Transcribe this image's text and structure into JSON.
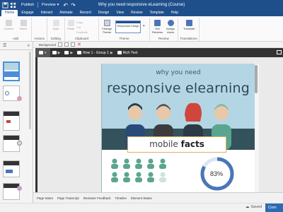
{
  "titlebar": {
    "publish_label": "Publish",
    "preview_label": "Preview",
    "window_title": "Why you need responsive eLearning (Course)"
  },
  "tabs": [
    "Home",
    "Engage",
    "Interact",
    "Animate",
    "Record",
    "Design",
    "View",
    "Review",
    "Template",
    "Help"
  ],
  "active_tab": "Home",
  "ribbon": {
    "groups": [
      {
        "label": "Add"
      },
      {
        "label": "Actions"
      },
      {
        "label": "Editing"
      },
      {
        "label": "Clipboard"
      },
      {
        "label": "Theme"
      },
      {
        "label": "Review"
      },
      {
        "label": "Translations"
      }
    ],
    "buttons": {
      "content": "Content",
      "block": "Block",
      "style": "Style",
      "paste": "Paste",
      "copy": "Copy",
      "cut": "Cut",
      "duplicate": "Duplicate",
      "change_theme": "Change Theme",
      "theme_name": "Responsive Design",
      "get_reviews": "Get Reviews",
      "assign_users": "Assign Users",
      "translate": "Translate"
    }
  },
  "canvas_toolbar": {
    "background_label": "Background"
  },
  "breadcrumb": {
    "items": [
      "Row 1 - Group 1",
      "Rich Text"
    ]
  },
  "slide": {
    "subtitle": "why you need",
    "title": "responsive elearning",
    "mobile_word": "mobile",
    "facts_word": "facts",
    "donut_value": "83%",
    "donut_fraction": 0.83
  },
  "bottom_tabs": [
    "Page Notes",
    "Page Transcript",
    "Reviewer Feedback",
    "Timeline",
    "Element States"
  ],
  "status": {
    "saved_label": "Saved",
    "commit_label": "Com"
  },
  "colors": {
    "brand": "#1f4f8b",
    "slide_bg": "#b4d6e4",
    "slide_dark": "#34525c",
    "accent_orange": "#e0b060",
    "donut": "#4a76b8",
    "person_green": "#5aa58f",
    "person_red": "#d0453c"
  }
}
